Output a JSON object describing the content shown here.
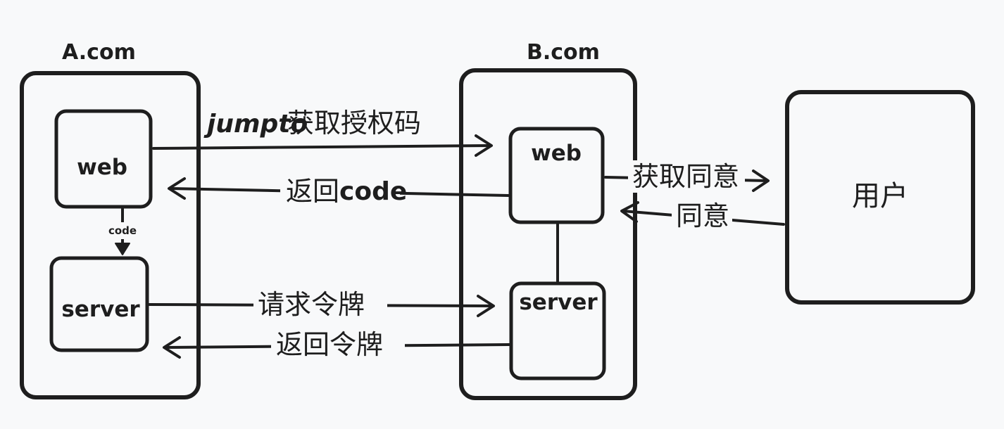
{
  "groups": {
    "a": {
      "title": "A.com"
    },
    "b": {
      "title": "B.com"
    }
  },
  "nodes": {
    "a_web": "web",
    "a_server": "server",
    "b_web": "web",
    "b_server": "server",
    "user": "用户"
  },
  "edges": {
    "jumpto_prefix": "jumpto",
    "jumpto_text": "获取授权码",
    "return_code_text": "返回",
    "return_code_suffix": "code",
    "a_internal": "code",
    "request_token": "请求令牌",
    "return_token": "返回令牌",
    "get_consent": "获取同意",
    "consent": "同意"
  }
}
